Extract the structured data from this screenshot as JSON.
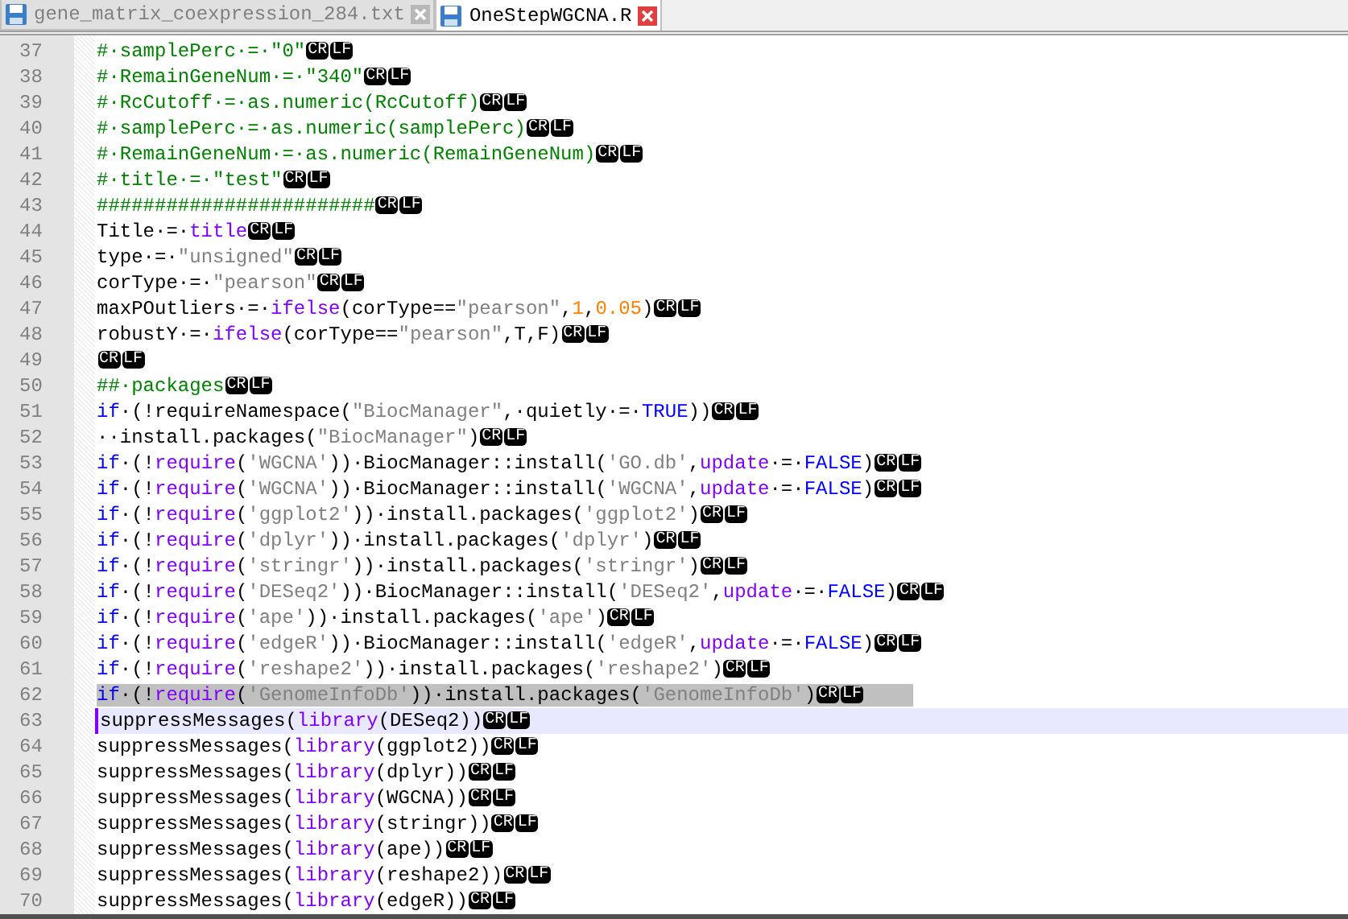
{
  "tabs": [
    {
      "label": "gene_matrix_coexpression_284.txt",
      "selected": false
    },
    {
      "label": "OneStepWGCNA.R",
      "selected": true
    }
  ],
  "lines": [
    {
      "number": "37",
      "selected": false,
      "current": false,
      "tokens": [
        {
          "kind": "comment",
          "text": "#·samplePerc·=·\"0\""
        },
        {
          "kind": "eol",
          "text": "CR"
        },
        {
          "kind": "eol",
          "text": "LF"
        }
      ]
    },
    {
      "number": "38",
      "selected": false,
      "current": false,
      "tokens": [
        {
          "kind": "comment",
          "text": "#·RemainGeneNum·=·\"340\""
        },
        {
          "kind": "eol",
          "text": "CR"
        },
        {
          "kind": "eol",
          "text": "LF"
        }
      ]
    },
    {
      "number": "39",
      "selected": false,
      "current": false,
      "tokens": [
        {
          "kind": "comment",
          "text": "#·RcCutoff·=·as.numeric(RcCutoff)"
        },
        {
          "kind": "eol",
          "text": "CR"
        },
        {
          "kind": "eol",
          "text": "LF"
        }
      ]
    },
    {
      "number": "40",
      "selected": false,
      "current": false,
      "tokens": [
        {
          "kind": "comment",
          "text": "#·samplePerc·=·as.numeric(samplePerc)"
        },
        {
          "kind": "eol",
          "text": "CR"
        },
        {
          "kind": "eol",
          "text": "LF"
        }
      ]
    },
    {
      "number": "41",
      "selected": false,
      "current": false,
      "tokens": [
        {
          "kind": "comment",
          "text": "#·RemainGeneNum·=·as.numeric(RemainGeneNum)"
        },
        {
          "kind": "eol",
          "text": "CR"
        },
        {
          "kind": "eol",
          "text": "LF"
        }
      ]
    },
    {
      "number": "42",
      "selected": false,
      "current": false,
      "tokens": [
        {
          "kind": "comment",
          "text": "#·title·=·\"test\""
        },
        {
          "kind": "eol",
          "text": "CR"
        },
        {
          "kind": "eol",
          "text": "LF"
        }
      ]
    },
    {
      "number": "43",
      "selected": false,
      "current": false,
      "tokens": [
        {
          "kind": "comment",
          "text": "########################"
        },
        {
          "kind": "eol",
          "text": "CR"
        },
        {
          "kind": "eol",
          "text": "LF"
        }
      ]
    },
    {
      "number": "44",
      "selected": false,
      "current": false,
      "tokens": [
        {
          "kind": "plain",
          "text": "Title·=·"
        },
        {
          "kind": "function",
          "text": "title"
        },
        {
          "kind": "eol",
          "text": "CR"
        },
        {
          "kind": "eol",
          "text": "LF"
        }
      ]
    },
    {
      "number": "45",
      "selected": false,
      "current": false,
      "tokens": [
        {
          "kind": "plain",
          "text": "type·=·"
        },
        {
          "kind": "string",
          "text": "\"unsigned\""
        },
        {
          "kind": "eol",
          "text": "CR"
        },
        {
          "kind": "eol",
          "text": "LF"
        }
      ]
    },
    {
      "number": "46",
      "selected": false,
      "current": false,
      "tokens": [
        {
          "kind": "plain",
          "text": "corType·=·"
        },
        {
          "kind": "string",
          "text": "\"pearson\""
        },
        {
          "kind": "eol",
          "text": "CR"
        },
        {
          "kind": "eol",
          "text": "LF"
        }
      ]
    },
    {
      "number": "47",
      "selected": false,
      "current": false,
      "tokens": [
        {
          "kind": "plain",
          "text": "maxPOutliers·=·"
        },
        {
          "kind": "function",
          "text": "ifelse"
        },
        {
          "kind": "plain",
          "text": "(corType=="
        },
        {
          "kind": "string",
          "text": "\"pearson\""
        },
        {
          "kind": "plain",
          "text": ","
        },
        {
          "kind": "number",
          "text": "1"
        },
        {
          "kind": "plain",
          "text": ","
        },
        {
          "kind": "number",
          "text": "0.05"
        },
        {
          "kind": "plain",
          "text": ")"
        },
        {
          "kind": "eol",
          "text": "CR"
        },
        {
          "kind": "eol",
          "text": "LF"
        }
      ]
    },
    {
      "number": "48",
      "selected": false,
      "current": false,
      "tokens": [
        {
          "kind": "plain",
          "text": "robustY·=·"
        },
        {
          "kind": "function",
          "text": "ifelse"
        },
        {
          "kind": "plain",
          "text": "(corType=="
        },
        {
          "kind": "string",
          "text": "\"pearson\""
        },
        {
          "kind": "plain",
          "text": ",T,F)"
        },
        {
          "kind": "eol",
          "text": "CR"
        },
        {
          "kind": "eol",
          "text": "LF"
        }
      ]
    },
    {
      "number": "49",
      "selected": false,
      "current": false,
      "tokens": [
        {
          "kind": "eol",
          "text": "CR"
        },
        {
          "kind": "eol",
          "text": "LF"
        }
      ]
    },
    {
      "number": "50",
      "selected": false,
      "current": false,
      "tokens": [
        {
          "kind": "comment",
          "text": "##·packages"
        },
        {
          "kind": "eol",
          "text": "CR"
        },
        {
          "kind": "eol",
          "text": "LF"
        }
      ]
    },
    {
      "number": "51",
      "selected": false,
      "current": false,
      "tokens": [
        {
          "kind": "keyword",
          "text": "if"
        },
        {
          "kind": "plain",
          "text": "·(!requireNamespace("
        },
        {
          "kind": "string",
          "text": "\"BiocManager\""
        },
        {
          "kind": "plain",
          "text": ",·quietly·=·"
        },
        {
          "kind": "keyword",
          "text": "TRUE"
        },
        {
          "kind": "plain",
          "text": "))"
        },
        {
          "kind": "eol",
          "text": "CR"
        },
        {
          "kind": "eol",
          "text": "LF"
        }
      ]
    },
    {
      "number": "52",
      "selected": false,
      "current": false,
      "tokens": [
        {
          "kind": "plain",
          "text": "··install.packages("
        },
        {
          "kind": "string",
          "text": "\"BiocManager\""
        },
        {
          "kind": "plain",
          "text": ")"
        },
        {
          "kind": "eol",
          "text": "CR"
        },
        {
          "kind": "eol",
          "text": "LF"
        }
      ]
    },
    {
      "number": "53",
      "selected": false,
      "current": false,
      "tokens": [
        {
          "kind": "keyword",
          "text": "if"
        },
        {
          "kind": "plain",
          "text": "·(!"
        },
        {
          "kind": "function",
          "text": "require"
        },
        {
          "kind": "plain",
          "text": "("
        },
        {
          "kind": "string",
          "text": "'WGCNA'"
        },
        {
          "kind": "plain",
          "text": "))·BiocManager::install("
        },
        {
          "kind": "string",
          "text": "'GO.db'"
        },
        {
          "kind": "plain",
          "text": ","
        },
        {
          "kind": "function",
          "text": "update"
        },
        {
          "kind": "plain",
          "text": "·=·"
        },
        {
          "kind": "keyword",
          "text": "FALSE"
        },
        {
          "kind": "plain",
          "text": ")"
        },
        {
          "kind": "eol",
          "text": "CR"
        },
        {
          "kind": "eol",
          "text": "LF"
        }
      ]
    },
    {
      "number": "54",
      "selected": false,
      "current": false,
      "tokens": [
        {
          "kind": "keyword",
          "text": "if"
        },
        {
          "kind": "plain",
          "text": "·(!"
        },
        {
          "kind": "function",
          "text": "require"
        },
        {
          "kind": "plain",
          "text": "("
        },
        {
          "kind": "string",
          "text": "'WGCNA'"
        },
        {
          "kind": "plain",
          "text": "))·BiocManager::install("
        },
        {
          "kind": "string",
          "text": "'WGCNA'"
        },
        {
          "kind": "plain",
          "text": ","
        },
        {
          "kind": "function",
          "text": "update"
        },
        {
          "kind": "plain",
          "text": "·=·"
        },
        {
          "kind": "keyword",
          "text": "FALSE"
        },
        {
          "kind": "plain",
          "text": ")"
        },
        {
          "kind": "eol",
          "text": "CR"
        },
        {
          "kind": "eol",
          "text": "LF"
        }
      ]
    },
    {
      "number": "55",
      "selected": false,
      "current": false,
      "tokens": [
        {
          "kind": "keyword",
          "text": "if"
        },
        {
          "kind": "plain",
          "text": "·(!"
        },
        {
          "kind": "function",
          "text": "require"
        },
        {
          "kind": "plain",
          "text": "("
        },
        {
          "kind": "string",
          "text": "'ggplot2'"
        },
        {
          "kind": "plain",
          "text": "))·install.packages("
        },
        {
          "kind": "string",
          "text": "'ggplot2'"
        },
        {
          "kind": "plain",
          "text": ")"
        },
        {
          "kind": "eol",
          "text": "CR"
        },
        {
          "kind": "eol",
          "text": "LF"
        }
      ]
    },
    {
      "number": "56",
      "selected": false,
      "current": false,
      "tokens": [
        {
          "kind": "keyword",
          "text": "if"
        },
        {
          "kind": "plain",
          "text": "·(!"
        },
        {
          "kind": "function",
          "text": "require"
        },
        {
          "kind": "plain",
          "text": "("
        },
        {
          "kind": "string",
          "text": "'dplyr'"
        },
        {
          "kind": "plain",
          "text": "))·install.packages("
        },
        {
          "kind": "string",
          "text": "'dplyr'"
        },
        {
          "kind": "plain",
          "text": ")"
        },
        {
          "kind": "eol",
          "text": "CR"
        },
        {
          "kind": "eol",
          "text": "LF"
        }
      ]
    },
    {
      "number": "57",
      "selected": false,
      "current": false,
      "tokens": [
        {
          "kind": "keyword",
          "text": "if"
        },
        {
          "kind": "plain",
          "text": "·(!"
        },
        {
          "kind": "function",
          "text": "require"
        },
        {
          "kind": "plain",
          "text": "("
        },
        {
          "kind": "string",
          "text": "'stringr'"
        },
        {
          "kind": "plain",
          "text": "))·install.packages("
        },
        {
          "kind": "string",
          "text": "'stringr'"
        },
        {
          "kind": "plain",
          "text": ")"
        },
        {
          "kind": "eol",
          "text": "CR"
        },
        {
          "kind": "eol",
          "text": "LF"
        }
      ]
    },
    {
      "number": "58",
      "selected": false,
      "current": false,
      "tokens": [
        {
          "kind": "keyword",
          "text": "if"
        },
        {
          "kind": "plain",
          "text": "·(!"
        },
        {
          "kind": "function",
          "text": "require"
        },
        {
          "kind": "plain",
          "text": "("
        },
        {
          "kind": "string",
          "text": "'DESeq2'"
        },
        {
          "kind": "plain",
          "text": "))·BiocManager::install("
        },
        {
          "kind": "string",
          "text": "'DESeq2'"
        },
        {
          "kind": "plain",
          "text": ","
        },
        {
          "kind": "function",
          "text": "update"
        },
        {
          "kind": "plain",
          "text": "·=·"
        },
        {
          "kind": "keyword",
          "text": "FALSE"
        },
        {
          "kind": "plain",
          "text": ")"
        },
        {
          "kind": "eol",
          "text": "CR"
        },
        {
          "kind": "eol",
          "text": "LF"
        }
      ]
    },
    {
      "number": "59",
      "selected": false,
      "current": false,
      "tokens": [
        {
          "kind": "keyword",
          "text": "if"
        },
        {
          "kind": "plain",
          "text": "·(!"
        },
        {
          "kind": "function",
          "text": "require"
        },
        {
          "kind": "plain",
          "text": "("
        },
        {
          "kind": "string",
          "text": "'ape'"
        },
        {
          "kind": "plain",
          "text": "))·install.packages("
        },
        {
          "kind": "string",
          "text": "'ape'"
        },
        {
          "kind": "plain",
          "text": ")"
        },
        {
          "kind": "eol",
          "text": "CR"
        },
        {
          "kind": "eol",
          "text": "LF"
        }
      ]
    },
    {
      "number": "60",
      "selected": false,
      "current": false,
      "tokens": [
        {
          "kind": "keyword",
          "text": "if"
        },
        {
          "kind": "plain",
          "text": "·(!"
        },
        {
          "kind": "function",
          "text": "require"
        },
        {
          "kind": "plain",
          "text": "("
        },
        {
          "kind": "string",
          "text": "'edgeR'"
        },
        {
          "kind": "plain",
          "text": "))·BiocManager::install("
        },
        {
          "kind": "string",
          "text": "'edgeR'"
        },
        {
          "kind": "plain",
          "text": ","
        },
        {
          "kind": "function",
          "text": "update"
        },
        {
          "kind": "plain",
          "text": "·=·"
        },
        {
          "kind": "keyword",
          "text": "FALSE"
        },
        {
          "kind": "plain",
          "text": ")"
        },
        {
          "kind": "eol",
          "text": "CR"
        },
        {
          "kind": "eol",
          "text": "LF"
        }
      ]
    },
    {
      "number": "61",
      "selected": false,
      "current": false,
      "tokens": [
        {
          "kind": "keyword",
          "text": "if"
        },
        {
          "kind": "plain",
          "text": "·(!"
        },
        {
          "kind": "function",
          "text": "require"
        },
        {
          "kind": "plain",
          "text": "("
        },
        {
          "kind": "string",
          "text": "'reshape2'"
        },
        {
          "kind": "plain",
          "text": "))·install.packages("
        },
        {
          "kind": "string",
          "text": "'reshape2'"
        },
        {
          "kind": "plain",
          "text": ")"
        },
        {
          "kind": "eol",
          "text": "CR"
        },
        {
          "kind": "eol",
          "text": "LF"
        }
      ]
    },
    {
      "number": "62",
      "selected": true,
      "current": false,
      "tokens": [
        {
          "kind": "keyword",
          "text": "if"
        },
        {
          "kind": "plain",
          "text": "·(!"
        },
        {
          "kind": "function",
          "text": "require"
        },
        {
          "kind": "plain",
          "text": "("
        },
        {
          "kind": "string",
          "text": "'GenomeInfoDb'"
        },
        {
          "kind": "plain",
          "text": "))·install.packages("
        },
        {
          "kind": "string",
          "text": "'GenomeInfoDb'"
        },
        {
          "kind": "plain",
          "text": ")"
        },
        {
          "kind": "eol",
          "text": "CR"
        },
        {
          "kind": "eol",
          "text": "LF"
        }
      ]
    },
    {
      "number": "63",
      "selected": false,
      "current": true,
      "tokens": [
        {
          "kind": "plain",
          "text": "suppressMessages("
        },
        {
          "kind": "function",
          "text": "library"
        },
        {
          "kind": "plain",
          "text": "(DESeq2))"
        },
        {
          "kind": "eol",
          "text": "CR"
        },
        {
          "kind": "eol",
          "text": "LF"
        }
      ]
    },
    {
      "number": "64",
      "selected": false,
      "current": false,
      "tokens": [
        {
          "kind": "plain",
          "text": "suppressMessages("
        },
        {
          "kind": "function",
          "text": "library"
        },
        {
          "kind": "plain",
          "text": "(ggplot2))"
        },
        {
          "kind": "eol",
          "text": "CR"
        },
        {
          "kind": "eol",
          "text": "LF"
        }
      ]
    },
    {
      "number": "65",
      "selected": false,
      "current": false,
      "tokens": [
        {
          "kind": "plain",
          "text": "suppressMessages("
        },
        {
          "kind": "function",
          "text": "library"
        },
        {
          "kind": "plain",
          "text": "(dplyr))"
        },
        {
          "kind": "eol",
          "text": "CR"
        },
        {
          "kind": "eol",
          "text": "LF"
        }
      ]
    },
    {
      "number": "66",
      "selected": false,
      "current": false,
      "tokens": [
        {
          "kind": "plain",
          "text": "suppressMessages("
        },
        {
          "kind": "function",
          "text": "library"
        },
        {
          "kind": "plain",
          "text": "(WGCNA))"
        },
        {
          "kind": "eol",
          "text": "CR"
        },
        {
          "kind": "eol",
          "text": "LF"
        }
      ]
    },
    {
      "number": "67",
      "selected": false,
      "current": false,
      "tokens": [
        {
          "kind": "plain",
          "text": "suppressMessages("
        },
        {
          "kind": "function",
          "text": "library"
        },
        {
          "kind": "plain",
          "text": "(stringr))"
        },
        {
          "kind": "eol",
          "text": "CR"
        },
        {
          "kind": "eol",
          "text": "LF"
        }
      ]
    },
    {
      "number": "68",
      "selected": false,
      "current": false,
      "tokens": [
        {
          "kind": "plain",
          "text": "suppressMessages("
        },
        {
          "kind": "function",
          "text": "library"
        },
        {
          "kind": "plain",
          "text": "(ape))"
        },
        {
          "kind": "eol",
          "text": "CR"
        },
        {
          "kind": "eol",
          "text": "LF"
        }
      ]
    },
    {
      "number": "69",
      "selected": false,
      "current": false,
      "tokens": [
        {
          "kind": "plain",
          "text": "suppressMessages("
        },
        {
          "kind": "function",
          "text": "library"
        },
        {
          "kind": "plain",
          "text": "(reshape2))"
        },
        {
          "kind": "eol",
          "text": "CR"
        },
        {
          "kind": "eol",
          "text": "LF"
        }
      ]
    },
    {
      "number": "70",
      "selected": false,
      "current": false,
      "tokens": [
        {
          "kind": "plain",
          "text": "suppressMessages("
        },
        {
          "kind": "function",
          "text": "library"
        },
        {
          "kind": "plain",
          "text": "(edgeR))"
        },
        {
          "kind": "eol",
          "text": "CR"
        },
        {
          "kind": "eol",
          "text": "LF"
        }
      ]
    }
  ]
}
